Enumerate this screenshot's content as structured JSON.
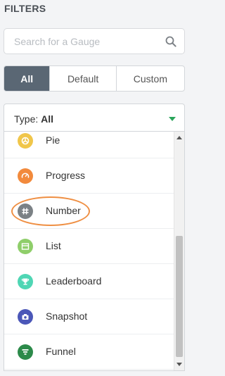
{
  "filters": {
    "title": "FILTERS"
  },
  "search": {
    "placeholder": "Search for a Gauge",
    "icon": "search-icon"
  },
  "segments": [
    {
      "label": "All",
      "active": true
    },
    {
      "label": "Default",
      "active": false
    },
    {
      "label": "Custom",
      "active": false
    }
  ],
  "type_select": {
    "prefix": "Type:",
    "value": "All",
    "caret_color": "#2aa55a"
  },
  "types": [
    {
      "label": "Pie",
      "icon": "pie-icon",
      "color": "#f0c64a"
    },
    {
      "label": "Progress",
      "icon": "progress-icon",
      "color": "#f28a3c"
    },
    {
      "label": "Number",
      "icon": "number-icon",
      "color": "#7b8185",
      "highlighted": true
    },
    {
      "label": "List",
      "icon": "list-icon",
      "color": "#8fce6a"
    },
    {
      "label": "Leaderboard",
      "icon": "trophy-icon",
      "color": "#4fd6b4"
    },
    {
      "label": "Snapshot",
      "icon": "camera-icon",
      "color": "#4b57b8"
    },
    {
      "label": "Funnel",
      "icon": "funnel-icon",
      "color": "#2c8a4a"
    }
  ],
  "colors": {
    "highlight_ring": "#ef8f43",
    "active_segment": "#5a6774"
  }
}
